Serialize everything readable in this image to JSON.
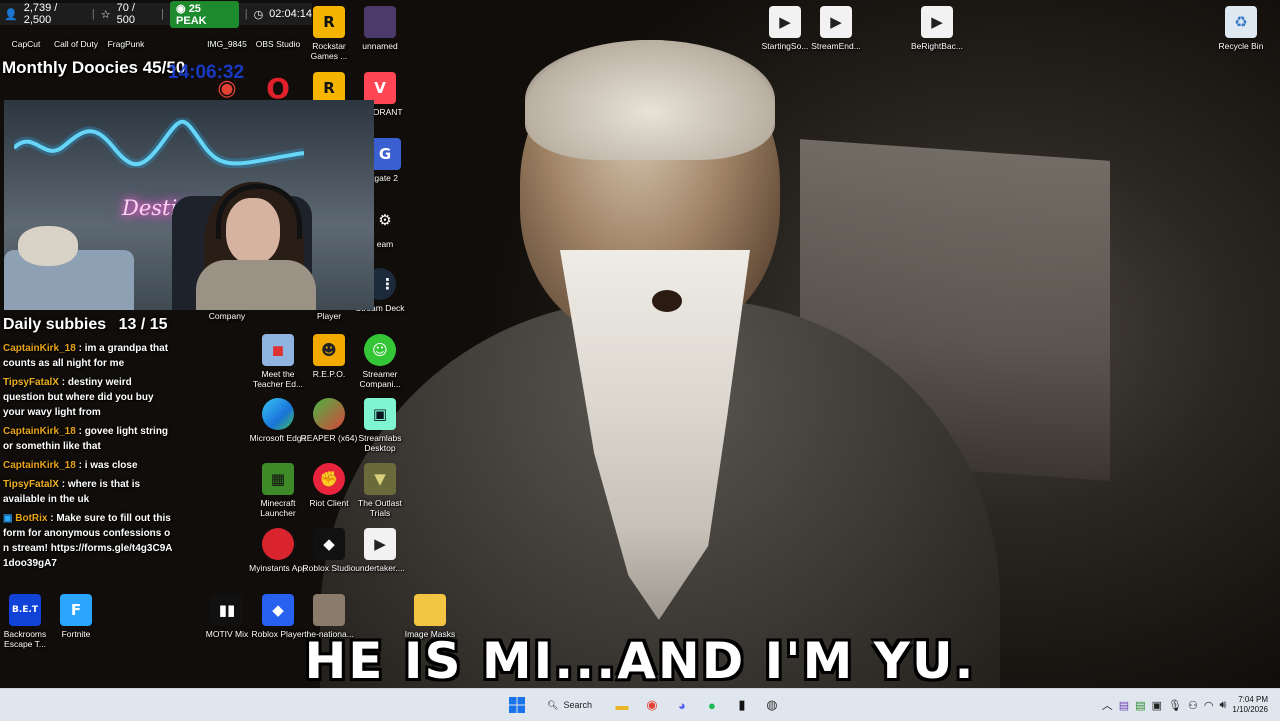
{
  "stats": {
    "followers": "2,739 / 2,500",
    "subs": "70 / 500",
    "peak": "25 PEAK",
    "uptime": "02:04:14"
  },
  "goal": {
    "title": "Monthly Doocies 45/50",
    "clock": "14:06:32"
  },
  "webcam": {
    "neon_sign": "Destiny"
  },
  "subbies": {
    "title": "Daily subbies",
    "count": "13 / 15"
  },
  "chat": [
    {
      "user": "CaptainKirk_18",
      "text": ": im a grandpa that counts as all night for me"
    },
    {
      "user": "TipsyFatalX",
      "text": ": destiny weird question but where did you buy your wavy light from"
    },
    {
      "user": "CaptainKirk_18",
      "text": ": govee light string or somethin like that"
    },
    {
      "user": "CaptainKirk_18",
      "text": ": i was close"
    },
    {
      "user": "TipsyFatalX",
      "text": ": where is that is available in the uk"
    },
    {
      "user": "BotRix",
      "text": ": Make sure to fill out this form for anonymous confessions on stream! https://forms.gle/t4g3C9A1doo39gA7"
    }
  ],
  "desktop_icons": {
    "capcut": "CapCut",
    "call_of_duty": "Call of Duty",
    "fragpunk": "FragPunk",
    "img": "IMG_9845",
    "obs": "OBS Studio",
    "rockstar": "Rockstar Games ...",
    "unnamed": "unnamed",
    "starting_soon": "StartingSo...",
    "stream_end": "StreamEnd...",
    "be_right_back": "BeRightBac...",
    "recycle_bin": "Recycle Bin",
    "valorant": "VALORANT",
    "gate": "tgate 2",
    "steam": "eam",
    "stream_deck": "Stream Deck",
    "company": "Company",
    "player": "Player",
    "meet_teacher": "Meet the Teacher Ed...",
    "repo": "R.E.P.O.",
    "streamer_companion": "Streamer Compani...",
    "edge": "Microsoft Edge",
    "reaper": "REAPER (x64)",
    "streamlabs": "Streamlabs Desktop",
    "minecraft": "Minecraft Launcher",
    "riot": "Riot Client",
    "outlast": "The Outlast Trials",
    "myinstants": "Myinstants App",
    "roblox_studio": "Roblox Studio",
    "undertaker": "undertaker....",
    "backrooms": "Backrooms Escape T...",
    "fortnite": "Fortnite",
    "motiv": "MOTIV Mix",
    "roblox_player": "Roblox Player",
    "the_national": "the-nationa...",
    "image_masks": "Image Masks"
  },
  "caption": "HE IS MI...AND I'M YU.",
  "taskbar": {
    "search": "Search",
    "time": "7:04 PM",
    "date": "1/10/2026"
  },
  "colors": {
    "taskbar_bg": "#dfe6ee",
    "peak_green": "#1e8a2e",
    "chat_user": "#e8a317",
    "bot_blue": "#2fa8ff"
  }
}
